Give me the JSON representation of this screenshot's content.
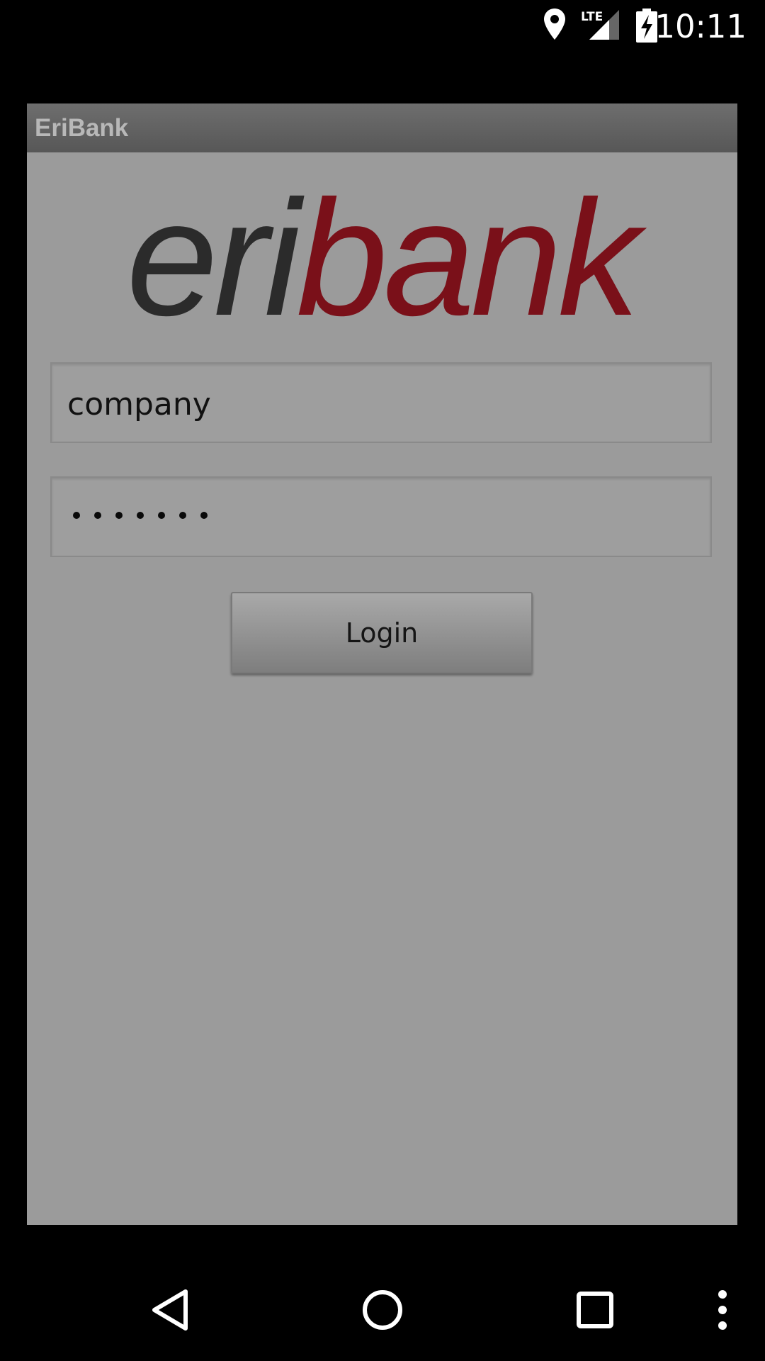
{
  "status_bar": {
    "time": "10:11",
    "network": "LTE",
    "icons": [
      "location-icon",
      "lte-signal-icon",
      "battery-charging-icon"
    ]
  },
  "app": {
    "title": "EriBank",
    "logo": {
      "part1": "eri",
      "part2": "bank",
      "colors": {
        "part1": "#2b2b2b",
        "part2": "#7a1019"
      }
    },
    "username_field": {
      "value": "company"
    },
    "password_field": {
      "masked_length": 7
    },
    "login_button": {
      "label": "Login"
    }
  },
  "nav_bar": {
    "buttons": [
      "back-icon",
      "home-icon",
      "recents-icon",
      "overflow-menu-icon"
    ]
  },
  "colors": {
    "screen_background": "#000000",
    "window_background": "#9b9b9b",
    "title_bar": "#5f5f5f",
    "title_text": "#b8b8b8"
  }
}
